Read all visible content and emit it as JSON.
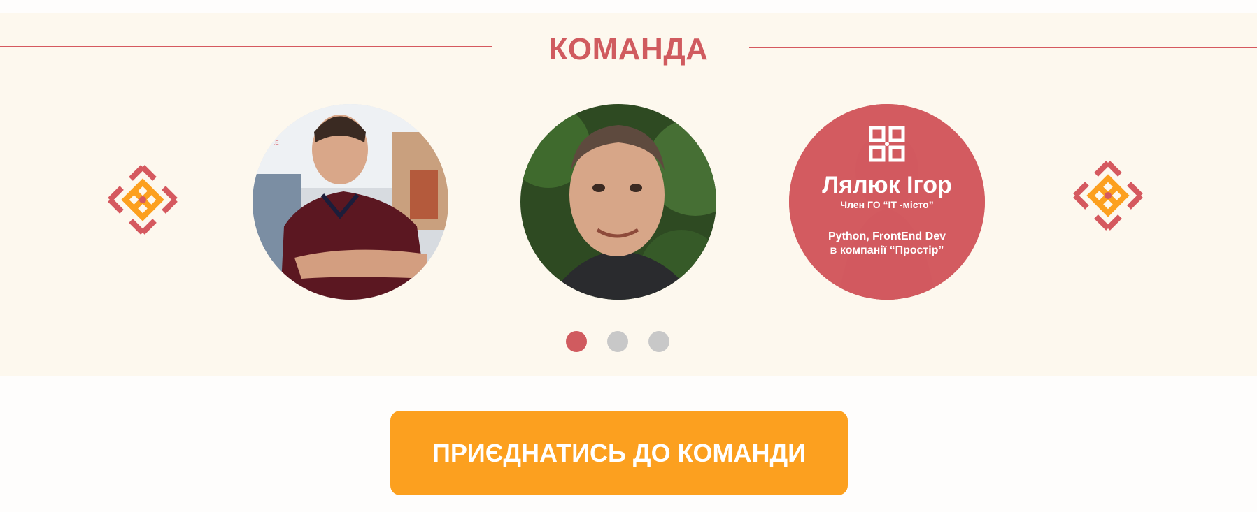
{
  "section": {
    "title": "КОМАНДА"
  },
  "carousel": {
    "prev_icon": "ornament-diamond-icon",
    "next_icon": "ornament-diamond-icon",
    "members": [
      {
        "photo": "member-photo-1"
      },
      {
        "photo": "member-photo-2"
      },
      {
        "photo": "member-photo-3",
        "logo_icon": "it-misto-logo-icon",
        "name": "Лялюк Ігор",
        "role": "Член ГО “IT -місто”",
        "desc_line1": "Python, FrontEnd Dev",
        "desc_line2": "в компанії “Простір”"
      }
    ],
    "pages": 3,
    "active_page": 1
  },
  "cta": {
    "label": "ПРИЄДНАТИСЬ ДО КОМАНДИ"
  },
  "colors": {
    "accent_red": "#d05b5f",
    "accent_orange": "#fca01f",
    "section_bg": "#fdf8ee",
    "dot_inactive": "#c8c8c8"
  }
}
